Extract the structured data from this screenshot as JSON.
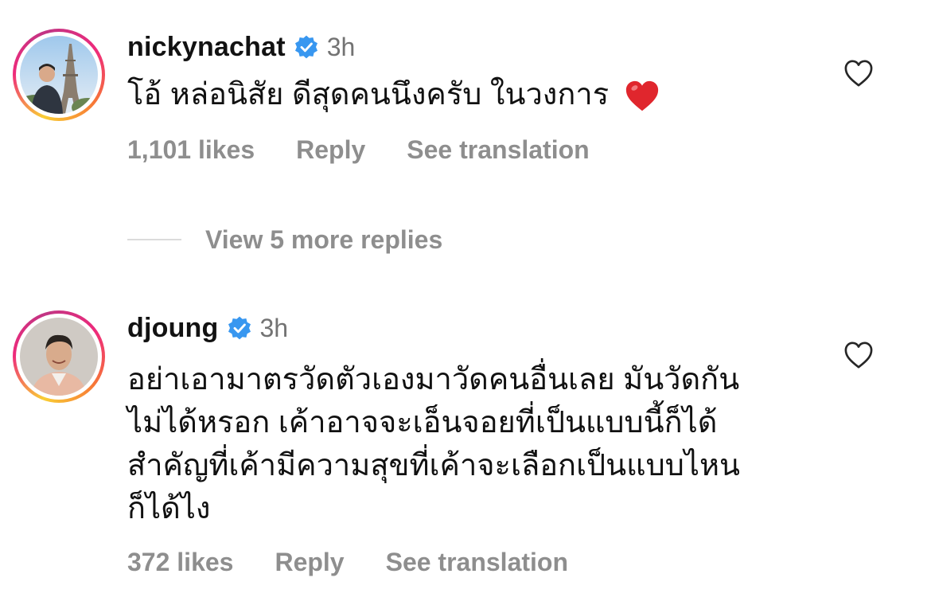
{
  "comments": [
    {
      "username": "nickynachat",
      "time": "3h",
      "text": "โอ้ หล่อนิสัย ดีสุดคนนึงครับ ในวงการ",
      "likes": "1,101 likes",
      "reply_label": "Reply",
      "translate_label": "See translation",
      "icons": {
        "verified": "verified-badge-icon",
        "like": "heart-outline-icon",
        "emoji": "red-heart-emoji"
      }
    },
    {
      "username": "djoung",
      "time": "3h",
      "text_lines": [
        "อย่าเอามาตรวัดตัวเองมาวัดคนอื่นเลย มันวัดกัน",
        "ไม่ได้หรอก เค้าอาจจะเอ็นจอยที่เป็นแบบนี้ก็ได้",
        "สำคัญที่เค้ามีความสุขที่เค้าจะเลือกเป็นแบบไหน",
        "ก็ได้ไง"
      ],
      "likes": "372 likes",
      "reply_label": "Reply",
      "translate_label": "See translation",
      "icons": {
        "verified": "verified-badge-icon",
        "like": "heart-outline-icon"
      }
    }
  ],
  "more_replies": {
    "label": "View 5 more replies"
  },
  "colors": {
    "verified_blue": "#3897f0",
    "meta_gray": "#8e8e8e",
    "heart_red": "#e0262d"
  }
}
